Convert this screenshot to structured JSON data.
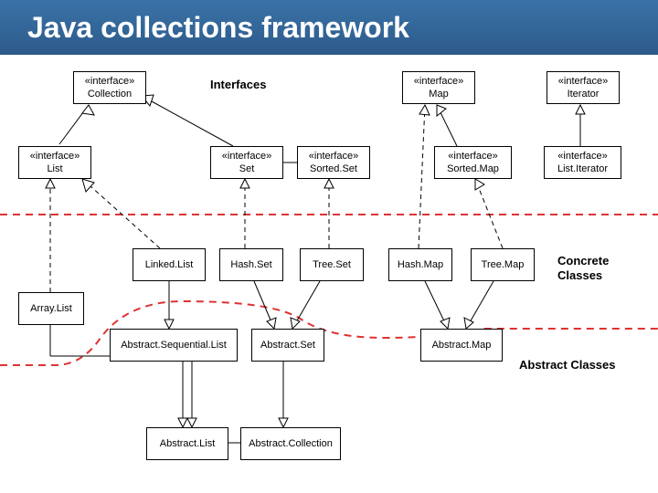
{
  "title": "Java collections framework",
  "labels": {
    "interfaces": "Interfaces",
    "concrete": "Concrete\nClasses",
    "abstract": "Abstract Classes"
  },
  "stereotype": "«interface»",
  "nodes": {
    "collection": "Collection",
    "map": "Map",
    "iterator": "Iterator",
    "list": "List",
    "set": "Set",
    "sortedset": "Sorted.Set",
    "sortedmap": "Sorted.Map",
    "listiterator": "List.Iterator",
    "linkedlist": "Linked.List",
    "hashset": "Hash.Set",
    "treeset": "Tree.Set",
    "hashmap": "Hash.Map",
    "treemap": "Tree.Map",
    "arraylist": "Array.List",
    "absseqlist": "Abstract.Sequential.List",
    "absset": "Abstract.Set",
    "absmap": "Abstract.Map",
    "abslist": "Abstract.List",
    "abscoll": "Abstract.Collection"
  }
}
